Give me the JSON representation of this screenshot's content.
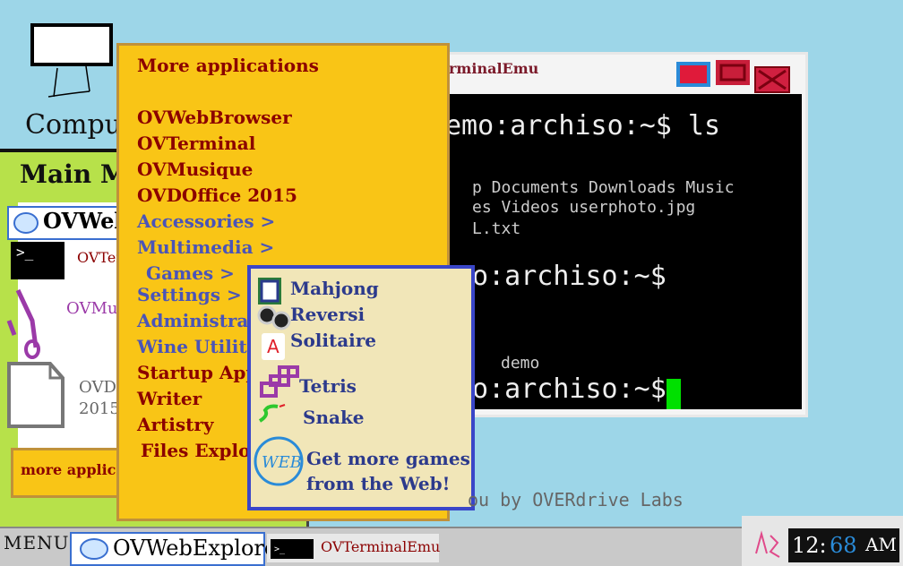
{
  "desktop": {
    "computer_label": "Compu"
  },
  "terminal": {
    "title": "rminalEmu",
    "lines": [
      "emo:archiso:~$ ls",
      "p Documents Downloads Music",
      "es Videos userphoto.jpg",
      "L.txt",
      "mo:archiso:~$",
      "demo",
      "mo:archiso:~$"
    ]
  },
  "main_menu": {
    "title": "Main Men",
    "entries": [
      "OVWebE",
      "OVTerm",
      "OVMusiq",
      "OVDOf",
      "2015",
      "more application"
    ]
  },
  "apps_menu": {
    "header": "More applications",
    "items": [
      {
        "label": "OVWebBrowser"
      },
      {
        "label": "OVTerminal"
      },
      {
        "label": "OVMusique"
      },
      {
        "label": "OVDOffice 2015"
      },
      {
        "label": "Accessories >"
      },
      {
        "label": "Multimedia >"
      },
      {
        "label": "Games >"
      },
      {
        "label": "Settings >"
      },
      {
        "label": "Administratio"
      },
      {
        "label": "Wine Utilities"
      },
      {
        "label": "Startup Applic"
      },
      {
        "label": "Writer"
      },
      {
        "label": "Artistry"
      },
      {
        "label": "Files Explorer"
      }
    ]
  },
  "games_menu": {
    "items": [
      "Mahjong",
      "Reversi",
      "Solitaire",
      "Tetris",
      "Snake"
    ],
    "more_line1": "Get more games",
    "more_line2": "from the Web!"
  },
  "credit": "ou by OVERdrive Labs",
  "taskbar": {
    "menu_label": "MENU",
    "task1": "OVWebExplorer",
    "task2": "OVTerminalEmu",
    "clock_hh": "12:",
    "clock_mm": "68",
    "clock_ampm": "AM"
  },
  "colors": {
    "desktop": "#9dd6e8",
    "menu_bg": "#f9c516",
    "panel_green": "#b7e14a",
    "games_blue": "#3a46c8"
  }
}
